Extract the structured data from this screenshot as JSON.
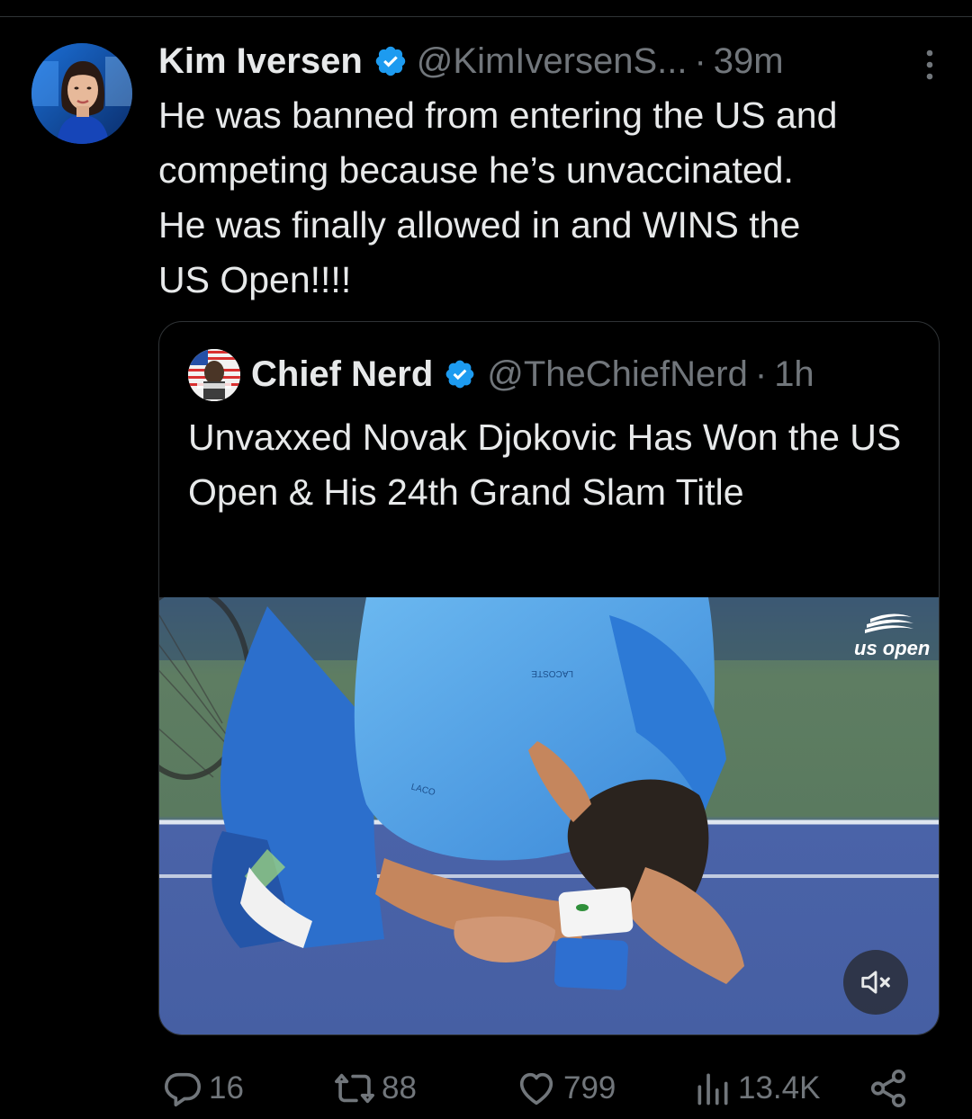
{
  "tweet": {
    "author": {
      "display_name": "Kim Iversen",
      "handle": "@KimIversenS...",
      "verified": true
    },
    "separator": "·",
    "time": "39m",
    "text": "He was banned from entering the US and\ncompeting because he’s unvaccinated.\nHe was finally allowed in and WINS the\nUS Open!!!!"
  },
  "quoted_tweet": {
    "author": {
      "display_name": "Chief Nerd",
      "handle": "@TheChiefNerd",
      "verified": true
    },
    "separator": "·",
    "time": "1h",
    "text": "Unvaxxed Novak Djokovic Has Won the US Open & His 24th Grand Slam Title",
    "media": {
      "watermark": "us open",
      "shirt_text": "LACOSTE",
      "sleeve_text": "LACO",
      "muted": true
    }
  },
  "actions": {
    "replies": "16",
    "reposts": "88",
    "likes": "799",
    "views": "13.4K"
  },
  "icons": {
    "more": "more-vertical-icon",
    "verified": "verified-badge-icon",
    "reply": "reply-icon",
    "repost": "repost-icon",
    "like": "heart-icon",
    "views": "views-chart-icon",
    "share": "share-icon",
    "mute": "speaker-muted-icon"
  },
  "colors": {
    "background": "#000000",
    "text": "#e7e9ea",
    "secondary": "#71767b",
    "verified": "#1d9bf0",
    "border": "#2f3336"
  }
}
